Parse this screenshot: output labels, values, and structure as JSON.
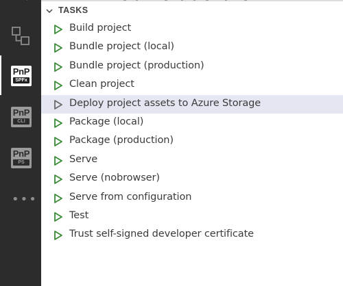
{
  "activity_bar": {
    "icons": [
      "partial-top-icon",
      "extensions-remote-icon",
      "pnp-spfx-icon",
      "pnp-cli-icon",
      "pnp-ps-icon",
      "more-icon"
    ],
    "pnp_spfx": {
      "top": "PnP",
      "sub": "SPFx"
    },
    "pnp_cli": {
      "top": "PnP",
      "sub": "CLI"
    },
    "pnp_ps": {
      "top": "PnP",
      "sub": "PS"
    },
    "more": "•••"
  },
  "panel": {
    "section_title": "TASKS",
    "tasks": [
      {
        "label": "Build project"
      },
      {
        "label": "Bundle project (local)"
      },
      {
        "label": "Bundle project (production)"
      },
      {
        "label": "Clean project"
      },
      {
        "label": "Deploy project assets to Azure Storage",
        "state": "hover"
      },
      {
        "label": "Package (local)"
      },
      {
        "label": "Package (production)"
      },
      {
        "label": "Serve"
      },
      {
        "label": "Serve (nobrowser)"
      },
      {
        "label": "Serve from configuration"
      },
      {
        "label": "Test"
      },
      {
        "label": "Trust self-signed developer certificate"
      }
    ]
  },
  "colors": {
    "activity_bar_bg": "#2c2c2c",
    "play_icon_green": "#388a34",
    "play_icon_hover_gray": "#6a6a6a",
    "hover_row_bg": "#e4e6f1",
    "text": "#3b3b3b"
  }
}
